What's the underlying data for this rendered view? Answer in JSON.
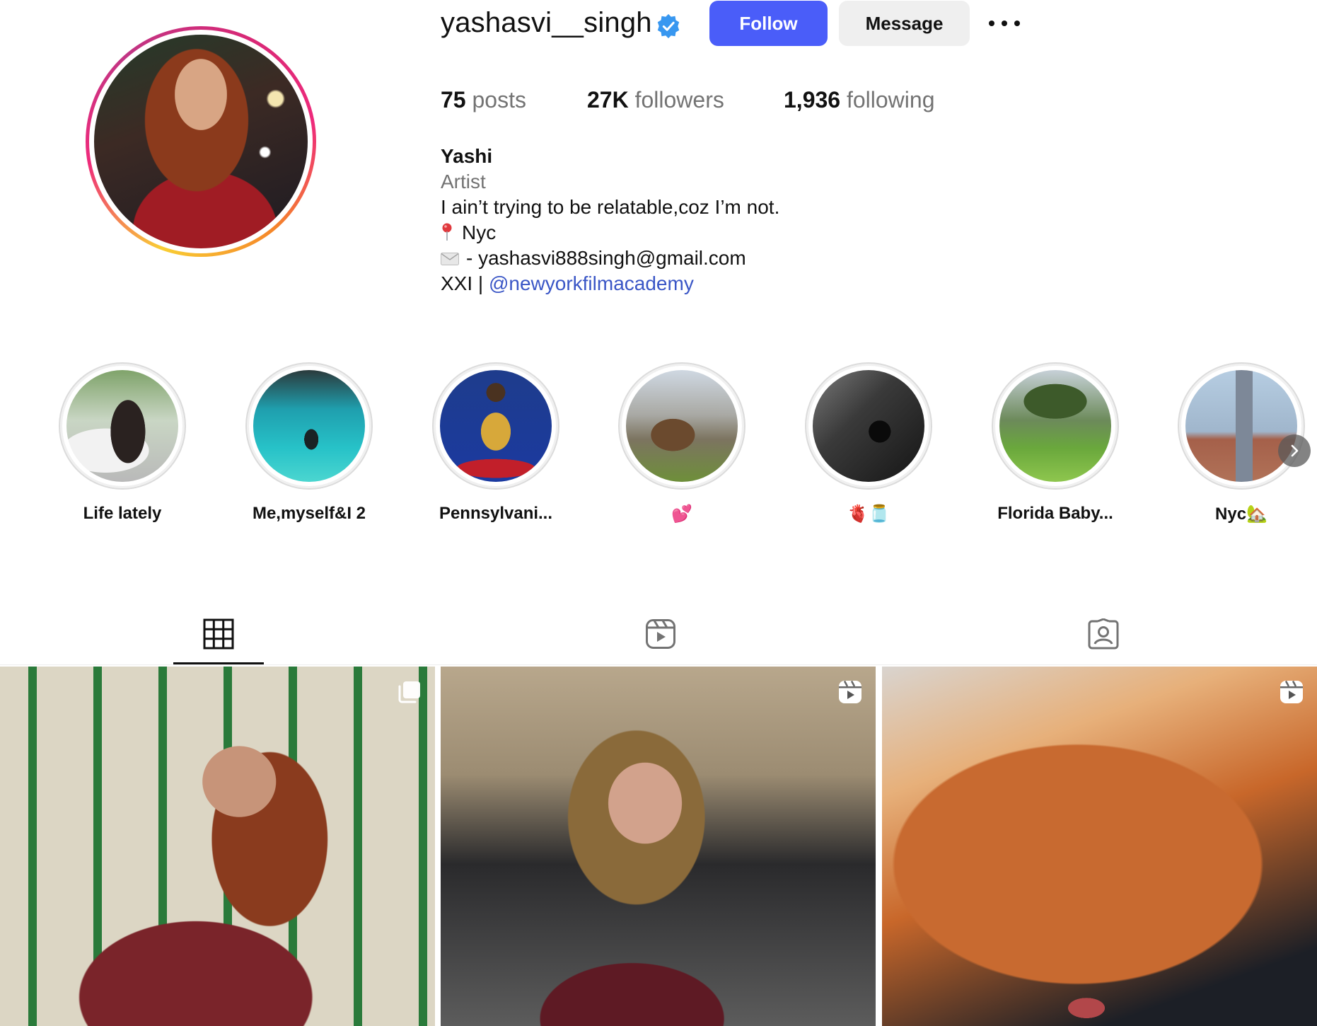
{
  "profile": {
    "username": "yashasvi__singh",
    "verified_icon": "verified-badge-icon",
    "follow_label": "Follow",
    "message_label": "Message",
    "more_icon": "more-options-icon"
  },
  "stats": {
    "posts_count": "75",
    "posts_label": "posts",
    "followers_count": "27K",
    "followers_label": "followers",
    "following_count": "1,936",
    "following_label": "following"
  },
  "bio": {
    "name": "Yashi",
    "category": "Artist",
    "line1": "I ain’t trying to be relatable,coz I’m not.",
    "location": "Nyc",
    "email_line": "- yashasvi888singh@gmail.com",
    "school_prefix": "XXI | ",
    "link": "@newyorkfilmacademy"
  },
  "highlights": [
    {
      "label": "Life lately"
    },
    {
      "label": "Me,myself&I 2"
    },
    {
      "label": "Pennsylvani..."
    },
    {
      "label": "💕"
    },
    {
      "label": "🫀🫙"
    },
    {
      "label": "Florida Baby..."
    },
    {
      "label": "Nyc🏡"
    }
  ],
  "tabs": [
    {
      "icon": "grid-icon",
      "active": true
    },
    {
      "icon": "reels-icon",
      "active": false
    },
    {
      "icon": "tagged-icon",
      "active": false
    }
  ],
  "posts": [
    {
      "badge_icon": "carousel-icon"
    },
    {
      "badge_icon": "reel-icon"
    },
    {
      "badge_icon": "reel-icon"
    }
  ],
  "colors": {
    "follow_button": "#4a5df9",
    "verified_badge": "#3897f0",
    "link": "#3a56c6",
    "secondary_text": "#737373"
  }
}
